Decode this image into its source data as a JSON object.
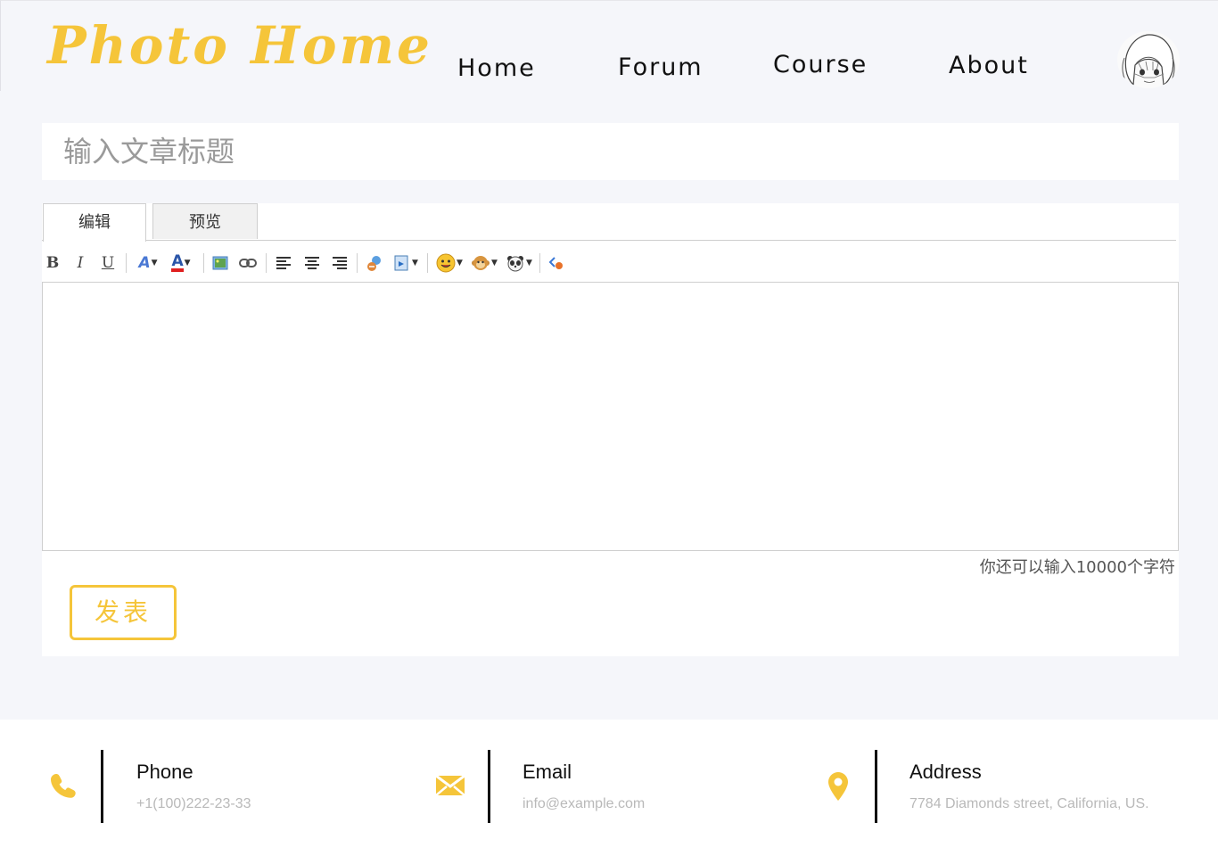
{
  "app": {
    "logo": "Photo Home"
  },
  "nav": {
    "items": [
      {
        "label": "Home"
      },
      {
        "label": "Forum"
      },
      {
        "label": "Course"
      },
      {
        "label": "About"
      }
    ]
  },
  "editor": {
    "title_placeholder": "输入文章标题",
    "tabs": [
      {
        "label": "编辑",
        "active": true
      },
      {
        "label": "预览",
        "active": false
      }
    ],
    "toolbar": {
      "bold": "B",
      "italic": "I",
      "underline": "U",
      "font": "A",
      "color": "A"
    },
    "counter": "你还可以输入10000个字符",
    "publish_label": "发表"
  },
  "footer": {
    "phone": {
      "label": "Phone",
      "value": "+1(100)222-23-33"
    },
    "email": {
      "label": "Email",
      "value": "info@example.com"
    },
    "address": {
      "label": "Address",
      "value": "7784 Diamonds street, California, US."
    }
  },
  "colors": {
    "accent": "#f5c53a",
    "background": "#f5f6fa",
    "text": "#111111"
  },
  "icons": [
    "avatar-image",
    "phone-icon",
    "envelope-icon",
    "location-pin-icon"
  ]
}
